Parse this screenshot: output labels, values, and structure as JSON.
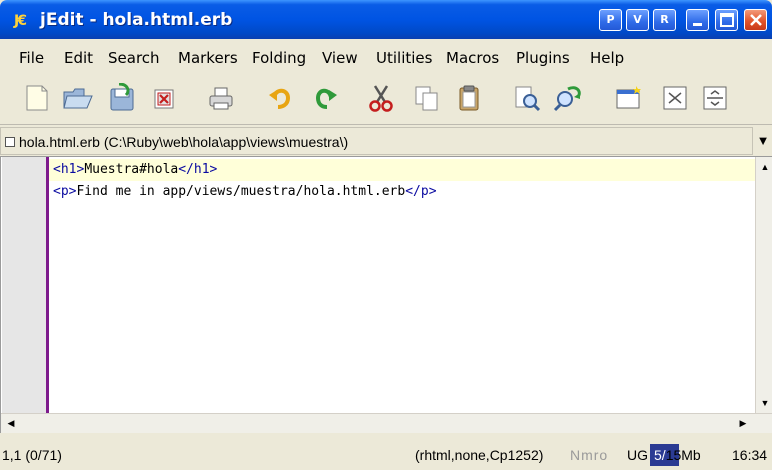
{
  "window": {
    "title": "jEdit - hola.html.erb",
    "app_icon_glyph": "J€",
    "buttons": [
      "P",
      "V",
      "R"
    ]
  },
  "menu": {
    "items": [
      "File",
      "Edit",
      "Search",
      "Markers",
      "Folding",
      "View",
      "Utilities",
      "Macros",
      "Plugins",
      "Help"
    ]
  },
  "toolbar": {
    "icons": [
      "new-file-icon",
      "open-file-icon",
      "save-icon",
      "close-icon",
      "print-icon",
      "undo-icon",
      "redo-icon",
      "cut-icon",
      "copy-icon",
      "paste-icon",
      "find-icon",
      "find-replace-icon",
      "new-view-icon",
      "split-horizontal-icon",
      "split-vertical-icon"
    ]
  },
  "buffer": {
    "label": "hola.html.erb (C:\\Ruby\\web\\hola\\app\\views\\muestra\\)"
  },
  "editor": {
    "lines": [
      {
        "open": "<h1>",
        "text": "Muestra#hola",
        "close": "</h1>"
      },
      {
        "open": "<p>",
        "text": "Find me in app/views/muestra/hola.html.erb",
        "close": "</p>"
      }
    ],
    "colors": {
      "tag": "#0a0aa0",
      "current_line": "#ffffd9",
      "gutter_accent": "#7d1a8c"
    }
  },
  "status": {
    "position": "1,1 (0/71)",
    "mode": "(rhtml,none,Cp1252)",
    "flags": "Nmro",
    "ug": "UG",
    "memory_used": "5/",
    "memory_total": "15Mb",
    "time": "16:34"
  }
}
